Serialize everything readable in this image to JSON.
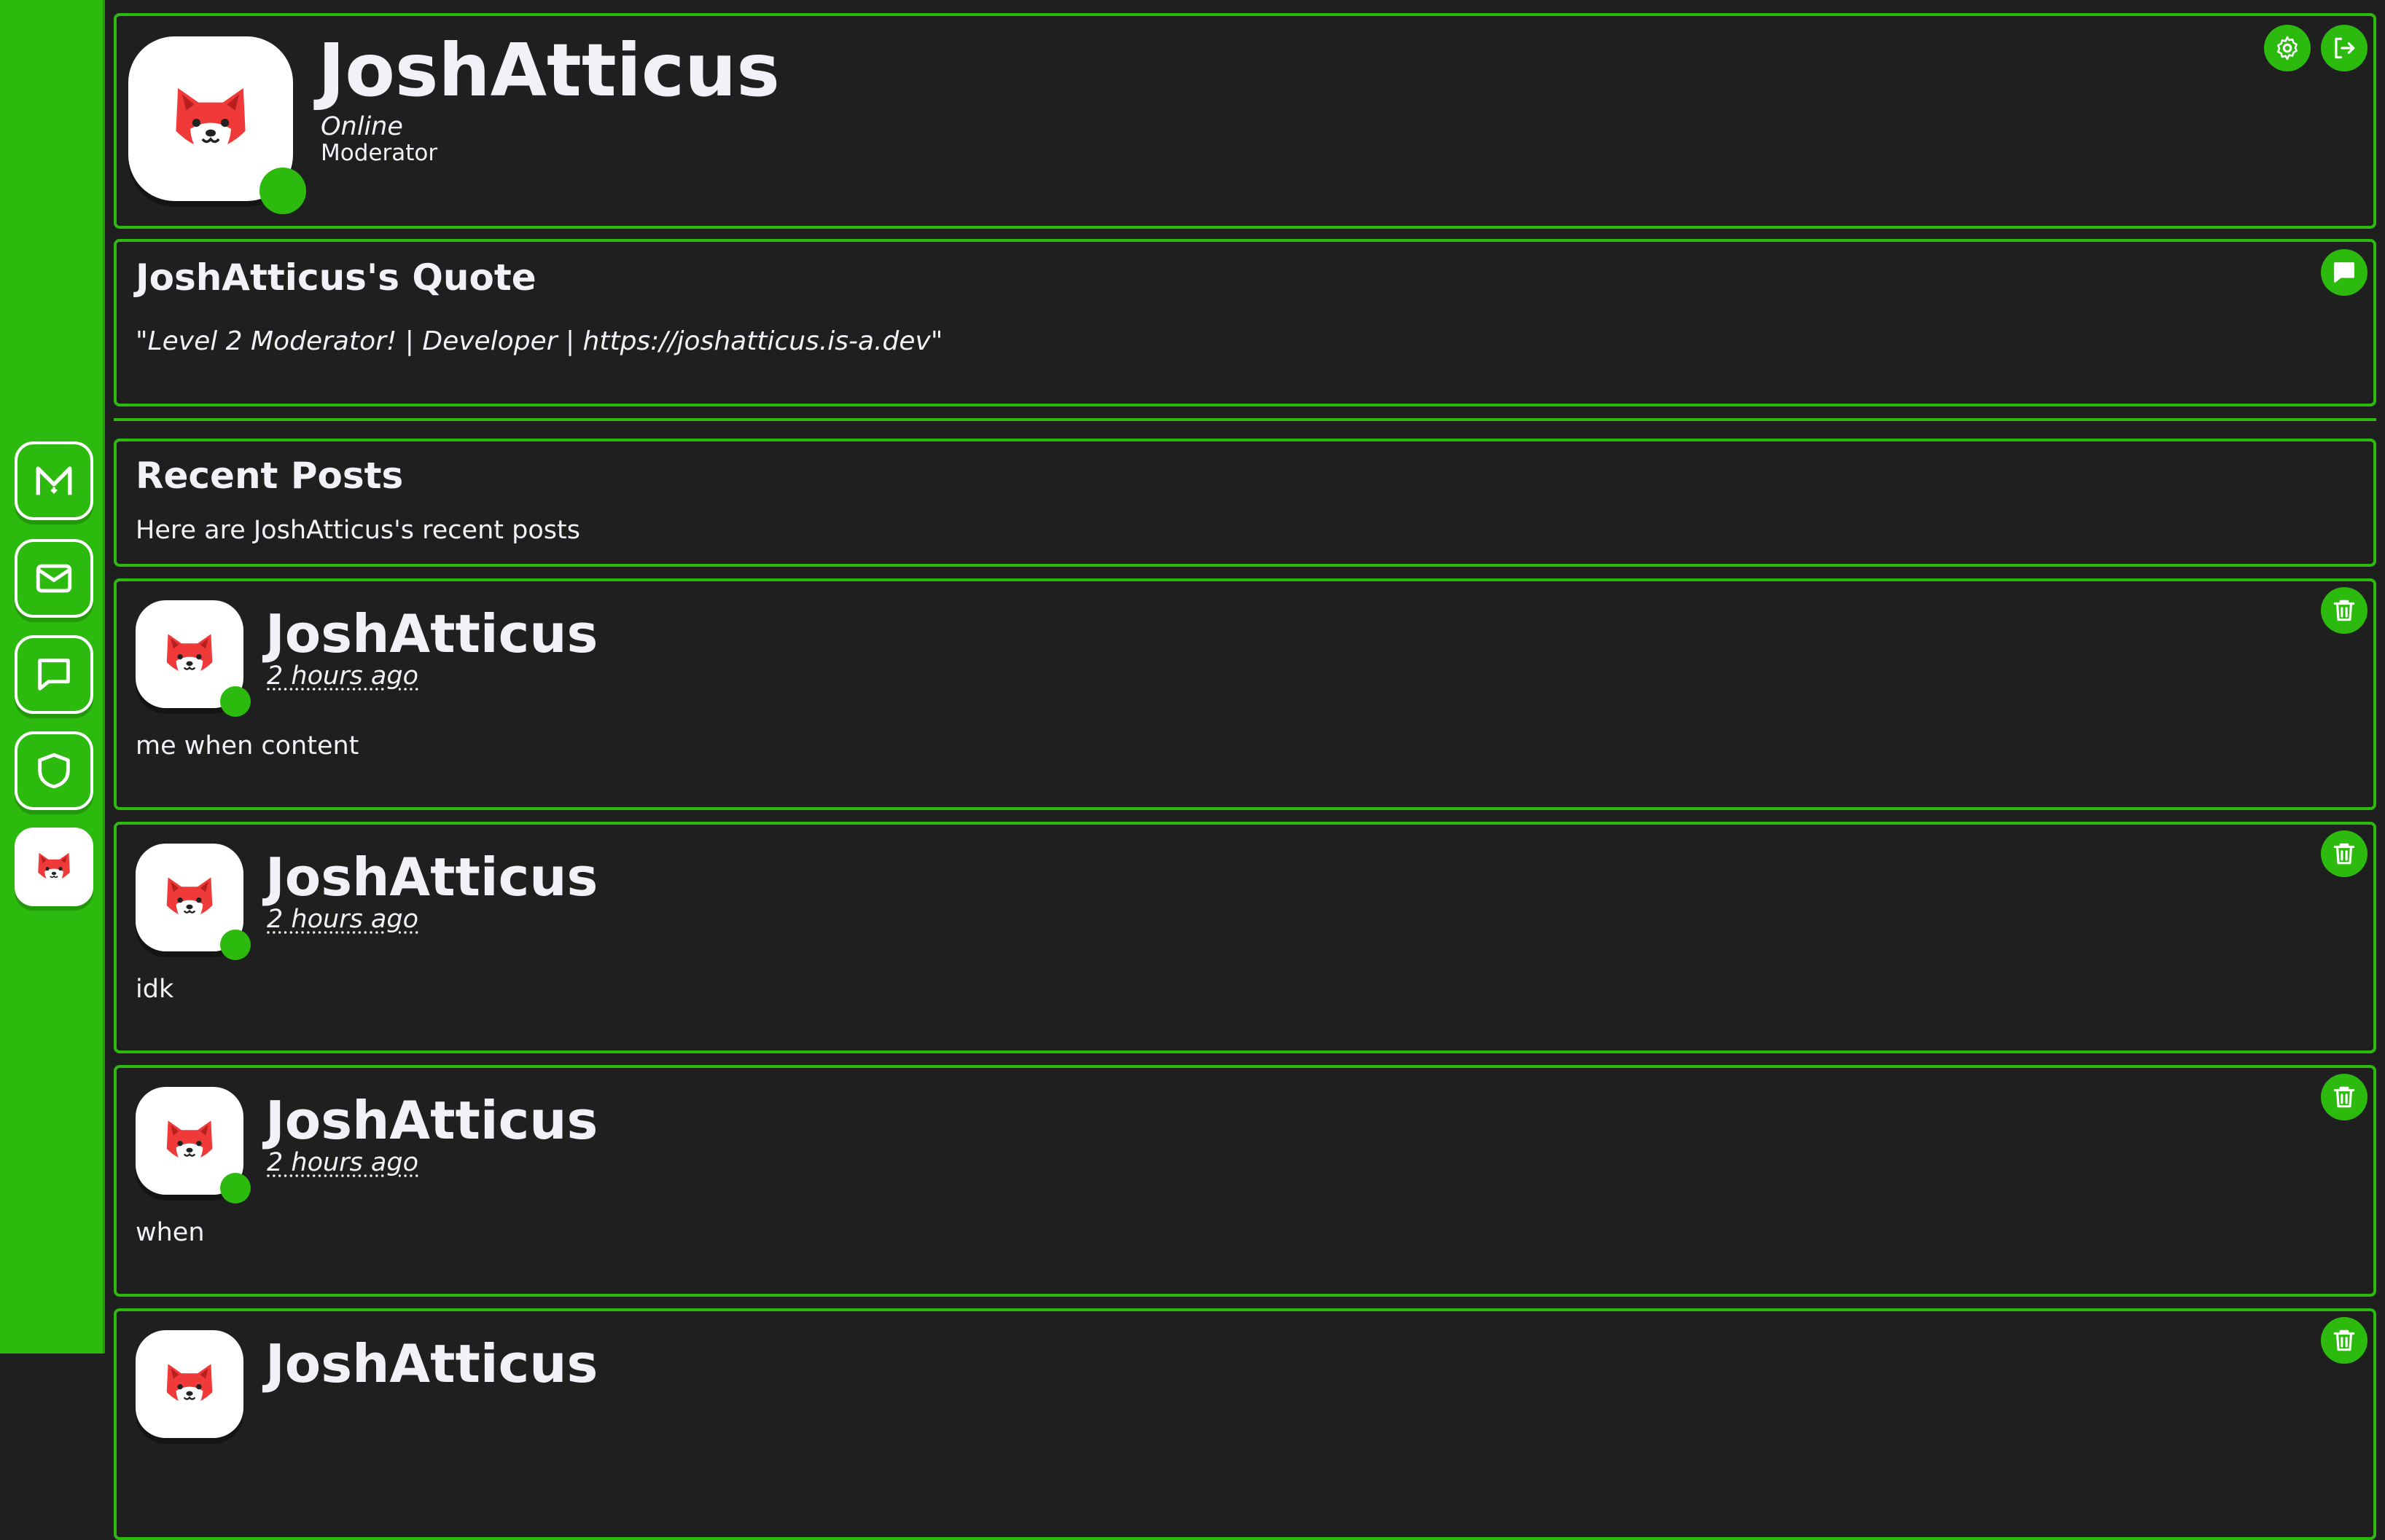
{
  "colors": {
    "accent": "#2dba0e",
    "background": "#1f1f1f",
    "text": "#f3f0f7",
    "avatar_red": "#f03a3a"
  },
  "sidebar": {
    "items": [
      {
        "icon": "logo-m-icon"
      },
      {
        "icon": "mail-icon"
      },
      {
        "icon": "chat-icon"
      },
      {
        "icon": "shield-icon"
      },
      {
        "icon": "user-avatar"
      }
    ]
  },
  "profile": {
    "username": "JoshAtticus",
    "status": "Online",
    "role": "Moderator",
    "actions": [
      {
        "icon": "gear-icon"
      },
      {
        "icon": "logout-icon"
      }
    ]
  },
  "quote": {
    "title": "JoshAtticus's Quote",
    "open_mark": "\"",
    "text": "Level 2 Moderator! | Developer | https://joshatticus.is-a.dev",
    "close_mark": "\"",
    "action_icon": "chat-bubble-icon"
  },
  "recent": {
    "title": "Recent Posts",
    "subtitle": "Here are JoshAtticus's recent posts"
  },
  "posts": [
    {
      "author": "JoshAtticus",
      "time": "2 hours ago",
      "content": "me when content"
    },
    {
      "author": "JoshAtticus",
      "time": "2 hours ago",
      "content": "idk"
    },
    {
      "author": "JoshAtticus",
      "time": "2 hours ago",
      "content": "when"
    },
    {
      "author": "JoshAtticus",
      "time": "",
      "content": ""
    }
  ]
}
